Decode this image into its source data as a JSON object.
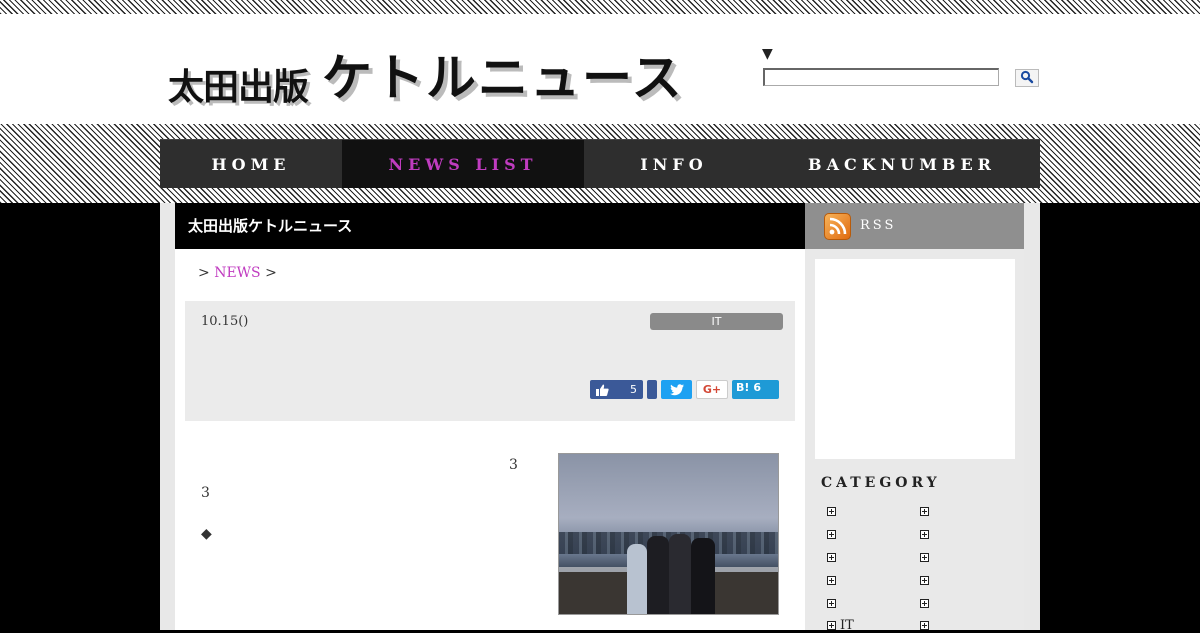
{
  "site": {
    "logo_publisher": "太田出版",
    "logo_title": "ケトルニュース"
  },
  "search": {
    "arrow": "▼",
    "placeholder": "",
    "button_icon": "search-icon"
  },
  "nav": {
    "items": [
      {
        "label": "HOME",
        "active": false
      },
      {
        "label": "NEWS LIST",
        "active": true
      },
      {
        "label": "INFO",
        "active": false
      },
      {
        "label": "BACKNUMBER",
        "active": false
      }
    ]
  },
  "main": {
    "header": "太田出版ケトルニュース",
    "breadcrumb": {
      "prefix": ">",
      "link": "NEWS",
      "suffix": ">"
    },
    "meta": {
      "date": "10.15()",
      "category": "IT"
    },
    "share": {
      "fb_count": "5",
      "gplus_label": "G+",
      "hatena_label": "B!",
      "hatena_count": "6"
    },
    "article": {
      "para1": "　　　　　　　　　　　　　　　　　　　　　　3　　　　　　　　　　　　　　　　　　　　　　　　　　　　　　　　　　　　　　3　　　　　　　　　　　　　　　　　　　　　　　　　　　　",
      "para2": "◆　　　　　　　　　　　　　　　　　　　　　",
      "para3": "　　　　　　　　　　　　　　　　　　　　　　　　　　　　　　“　”　　　　　　　　　　　　　　　　　　　　　　　　　　　　　　　　　　　　　"
    }
  },
  "sidebar": {
    "rss_label": "RSS",
    "category_title": "CATEGORY",
    "categories_left": [
      "",
      "",
      "",
      "",
      "",
      "IT"
    ],
    "categories_right": [
      "",
      "",
      "",
      "",
      "",
      ""
    ]
  },
  "colors": {
    "accent": "#c03cc0",
    "nav_bg": "#2e2e2e",
    "facebook": "#3b5998",
    "twitter": "#1da1f2",
    "hatena": "#1e9ad6",
    "rss": "#e06b10"
  }
}
